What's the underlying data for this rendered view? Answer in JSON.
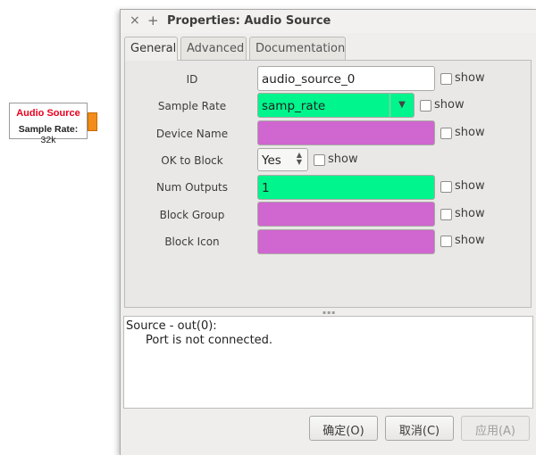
{
  "canvas_block": {
    "title": "Audio Source",
    "param_label": "Sample Rate:",
    "param_value": "32k",
    "title_color": "#e8001c",
    "port_color": "#f28c1a"
  },
  "dialog": {
    "title": "Properties: Audio Source",
    "close_glyph": "×",
    "maximize_glyph": "+",
    "tabs": [
      {
        "label": "General",
        "active": true
      },
      {
        "label": "Advanced",
        "active": false
      },
      {
        "label": "Documentation",
        "active": false
      }
    ],
    "fields": [
      {
        "label": "ID",
        "value": "audio_source_0",
        "type": "entry",
        "color": "#ffffff",
        "show": "show"
      },
      {
        "label": "Sample Rate",
        "value": "samp_rate",
        "type": "combo",
        "color": "#00f58c",
        "show": "show"
      },
      {
        "label": "Device Name",
        "value": "",
        "type": "entry",
        "color": "#d066cf",
        "show": "show"
      },
      {
        "label": "OK to Block",
        "value": "Yes",
        "type": "spin",
        "color": "#f7f7f6",
        "show": "show"
      },
      {
        "label": "Num Outputs",
        "value": "1",
        "type": "entry",
        "color": "#00f58c",
        "show": "show"
      },
      {
        "label": "Block Group",
        "value": "",
        "type": "entry",
        "color": "#d066cf",
        "show": "show"
      },
      {
        "label": "Block Icon",
        "value": "",
        "type": "entry",
        "color": "#d066cf",
        "show": "show"
      }
    ],
    "console": {
      "line1": "Source - out(0):",
      "line2": "Port is not connected."
    },
    "buttons": {
      "ok": "确定(O)",
      "cancel": "取消(C)",
      "apply": "应用(A)"
    }
  }
}
